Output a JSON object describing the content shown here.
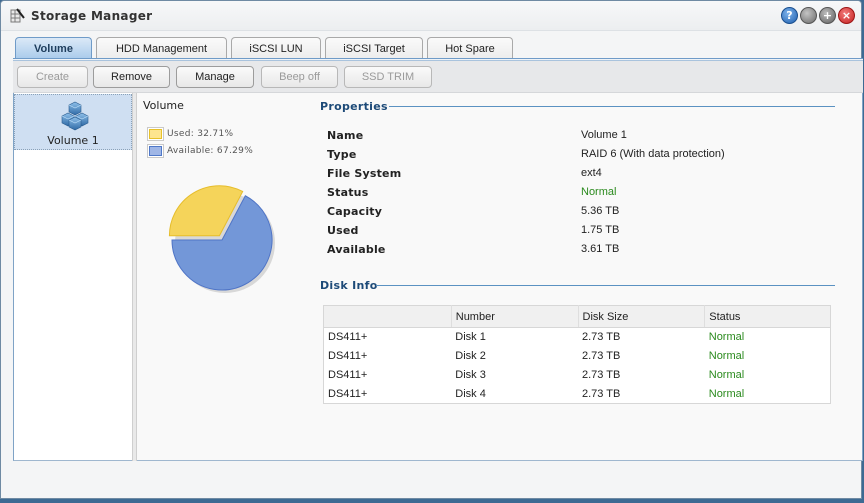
{
  "window": {
    "title": "Storage Manager",
    "controls": {
      "help": "?",
      "minimize": "",
      "maximize": "+",
      "close": "×"
    }
  },
  "tabs": [
    {
      "label": "Volume",
      "active": true
    },
    {
      "label": "HDD Management",
      "active": false
    },
    {
      "label": "iSCSI LUN",
      "active": false
    },
    {
      "label": "iSCSI Target",
      "active": false
    },
    {
      "label": "Hot Spare",
      "active": false
    }
  ],
  "toolbar": {
    "create": "Create",
    "remove": "Remove",
    "manage": "Manage",
    "beep_off": "Beep off",
    "ssd_trim": "SSD TRIM"
  },
  "volumes": [
    {
      "label": "Volume 1",
      "icon": "cubes-icon",
      "selected": true
    }
  ],
  "usage": {
    "heading": "Volume",
    "legend_used": "Used: 32.71%",
    "legend_available": "Available: 67.29%"
  },
  "chart_data": {
    "type": "pie",
    "title": "Volume",
    "slices": [
      {
        "label": "Used",
        "value": 32.71,
        "color": "#f5d45a",
        "exploded": true
      },
      {
        "label": "Available",
        "value": 67.29,
        "color": "#7397d8",
        "exploded": false
      }
    ],
    "legend": "top-left"
  },
  "properties": {
    "title": "Properties",
    "rows": [
      {
        "label": "Name",
        "value": "Volume 1"
      },
      {
        "label": "Type",
        "value": "RAID 6 (With data protection)"
      },
      {
        "label": "File System",
        "value": "ext4"
      },
      {
        "label": "Status",
        "value": "Normal"
      },
      {
        "label": "Capacity",
        "value": "5.36 TB"
      },
      {
        "label": "Used",
        "value": "1.75 TB"
      },
      {
        "label": "Available",
        "value": "3.61 TB"
      }
    ]
  },
  "disk_info": {
    "title": "Disk Info",
    "columns": [
      "",
      "Number",
      "Disk Size",
      "Status"
    ],
    "rows": [
      [
        "DS411+",
        "Disk 1",
        "2.73 TB",
        "Normal"
      ],
      [
        "DS411+",
        "Disk 2",
        "2.73 TB",
        "Normal"
      ],
      [
        "DS411+",
        "Disk 3",
        "2.73 TB",
        "Normal"
      ],
      [
        "DS411+",
        "Disk 4",
        "2.73 TB",
        "Normal"
      ]
    ]
  },
  "colors": {
    "status_normal": "#2a8a1d",
    "section_title": "#1d4a78",
    "accent": "#5b92c2"
  }
}
